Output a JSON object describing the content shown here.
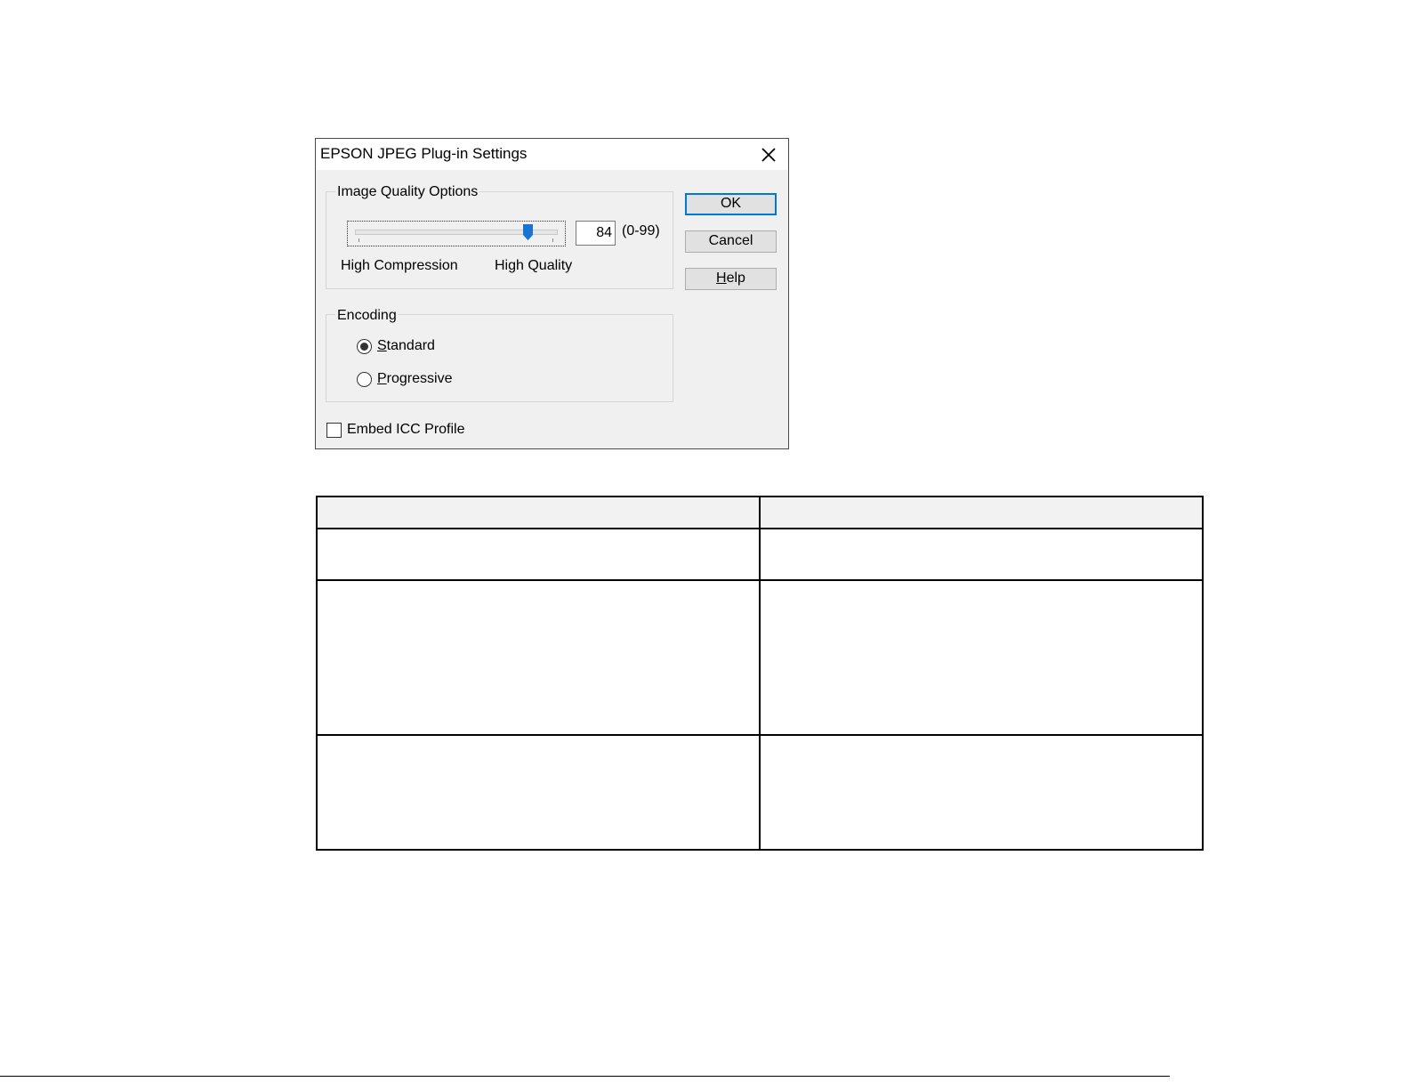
{
  "dialog": {
    "title": "EPSON JPEG Plug-in Settings",
    "close_icon": "close-icon",
    "image_quality": {
      "group_label": "Image Quality Options",
      "quality_value": "84",
      "quality_fraction": 0.85,
      "range_label": "(0-99)",
      "min_label": "High Compression",
      "max_label": "High Quality"
    },
    "encoding": {
      "group_label": "Encoding",
      "options": [
        {
          "accel": "S",
          "rest": "tandard",
          "selected": true
        },
        {
          "accel": "P",
          "rest": "rogressive",
          "selected": false
        }
      ]
    },
    "embed_icc": {
      "label": "Embed ICC Profile",
      "checked": false
    },
    "buttons": {
      "ok": "OK",
      "cancel": "Cancel",
      "help_accel": "H",
      "help_rest": "elp"
    }
  },
  "colors": {
    "accent": "#0078d7",
    "thumb": "#1874d2"
  }
}
